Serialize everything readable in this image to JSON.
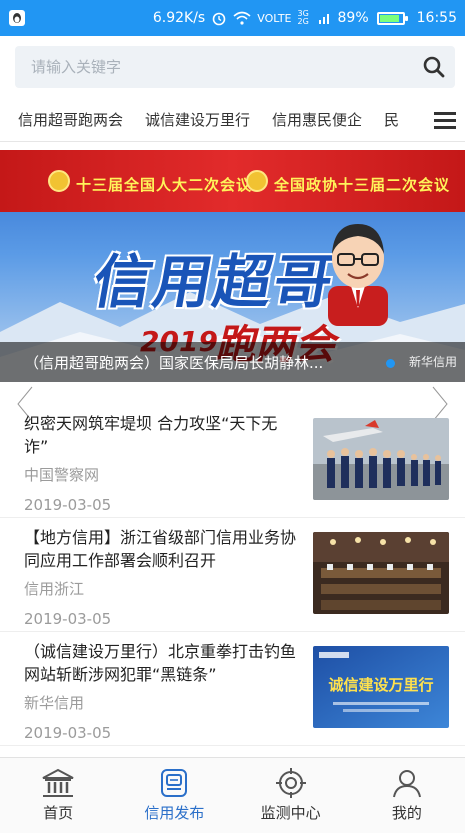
{
  "status_bar": {
    "speed": "6.92K/s",
    "network": "VOLTE",
    "signal_gen": "3G 2G",
    "battery": "89%",
    "battery_level": 0.89,
    "time": "16:55"
  },
  "search": {
    "placeholder": "请输入关键字",
    "value": ""
  },
  "tabs": [
    "信用超哥跑两会",
    "诚信建设万里行",
    "信用惠民便企",
    "民"
  ],
  "banner": {
    "line1_left": "十三届全国人大二次会议",
    "line1_right": "全国政协十三届二次会议",
    "big_title": "信用超哥",
    "year": "2019",
    "subtitle": "跑两会",
    "caption": "（信用超哥跑两会）国家医保局局长胡静林...",
    "watermark": "新华信用"
  },
  "news": [
    {
      "title": "织密天网筑牢堤坝 合力攻坚“天下无诈”",
      "source": "中国警察网",
      "date": "2019-03-05"
    },
    {
      "title": "【地方信用】浙江省级部门信用业务协同应用工作部署会顺利召开",
      "source": "信用浙江",
      "date": "2019-03-05"
    },
    {
      "title": "（诚信建设万里行）北京重拳打击钓鱼网站斩断涉网犯罪“黑链条”",
      "source": "新华信用",
      "date": "2019-03-05"
    }
  ],
  "thumb3_text": "诚信建设万里行",
  "bottom_nav": [
    {
      "label": "首页",
      "icon": "home-icon"
    },
    {
      "label": "信用发布",
      "icon": "credit-publish-icon",
      "active": true
    },
    {
      "label": "监测中心",
      "icon": "monitor-icon"
    },
    {
      "label": "我的",
      "icon": "user-icon"
    }
  ],
  "colors": {
    "status_bar": "#2196f3",
    "accent": "#2a6fc9"
  }
}
